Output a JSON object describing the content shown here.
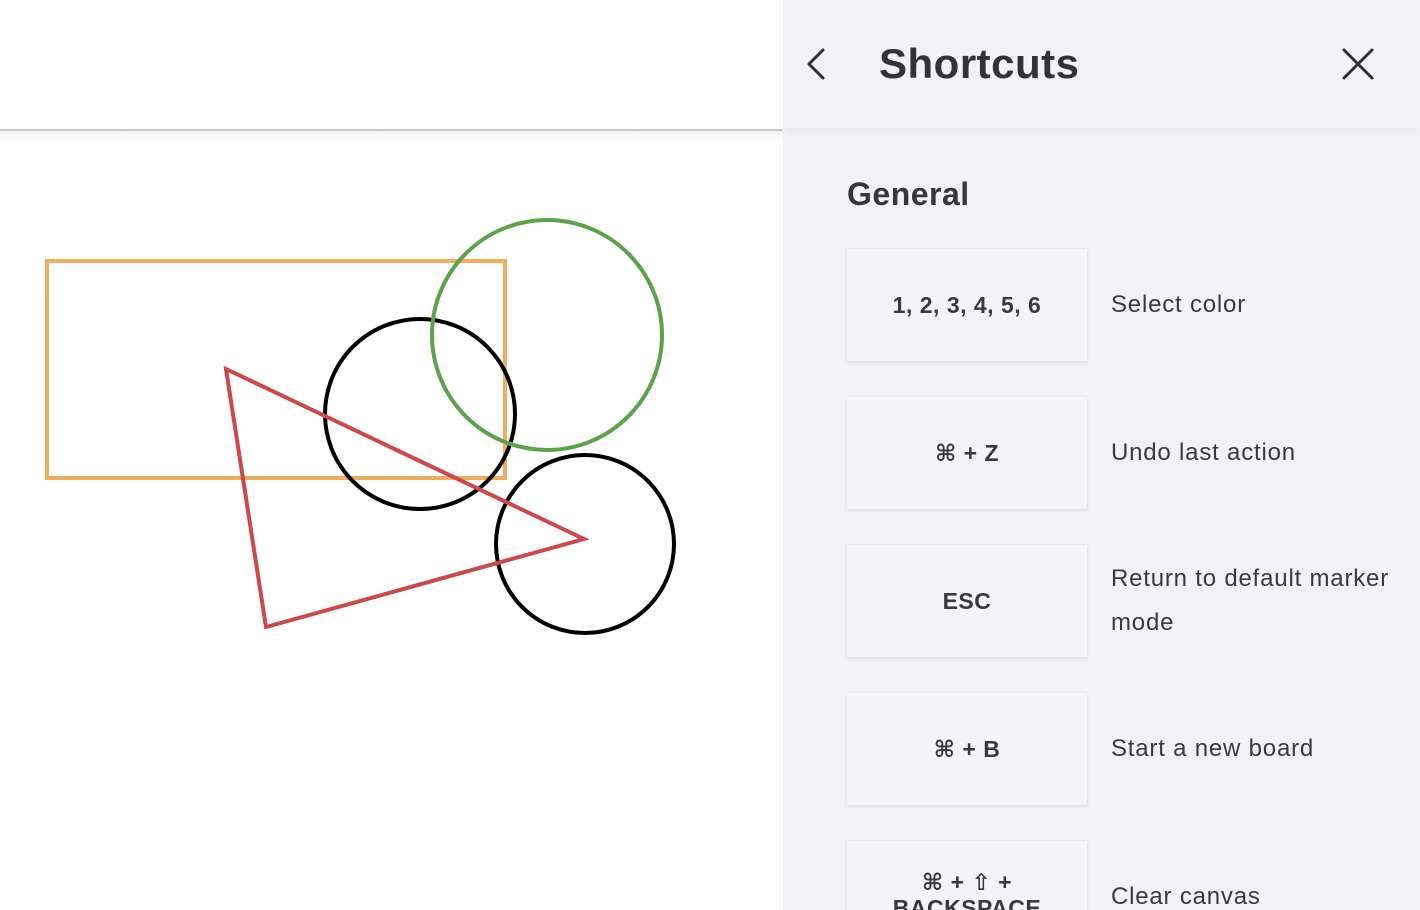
{
  "canvas": {
    "shapes": [
      {
        "kind": "rectangle",
        "color": "#f2ad5a"
      },
      {
        "kind": "circle",
        "color": "#5ba34a"
      },
      {
        "kind": "circle",
        "color": "#000000"
      },
      {
        "kind": "circle",
        "color": "#000000"
      },
      {
        "kind": "triangle",
        "color": "#cf4848"
      }
    ]
  },
  "panel": {
    "title": "Shortcuts",
    "back_icon": "chevron-left-icon",
    "close_icon": "close-icon",
    "section_heading": "General",
    "shortcuts": [
      {
        "keys": "1, 2, 3, 4, 5, 6",
        "description": "Select color"
      },
      {
        "keys": "⌘ + Z",
        "description": "Undo last action"
      },
      {
        "keys": "ESC",
        "description": "Return to default marker mode"
      },
      {
        "keys": "⌘ + B",
        "description": "Start a new board"
      },
      {
        "keys": "⌘ + ⇧ + BACKSPACE",
        "description": "Clear canvas"
      }
    ]
  },
  "colors": {
    "panel_background": "#f2f2f6",
    "key_background": "#f4f4f6",
    "text": "#3a3a3d"
  }
}
